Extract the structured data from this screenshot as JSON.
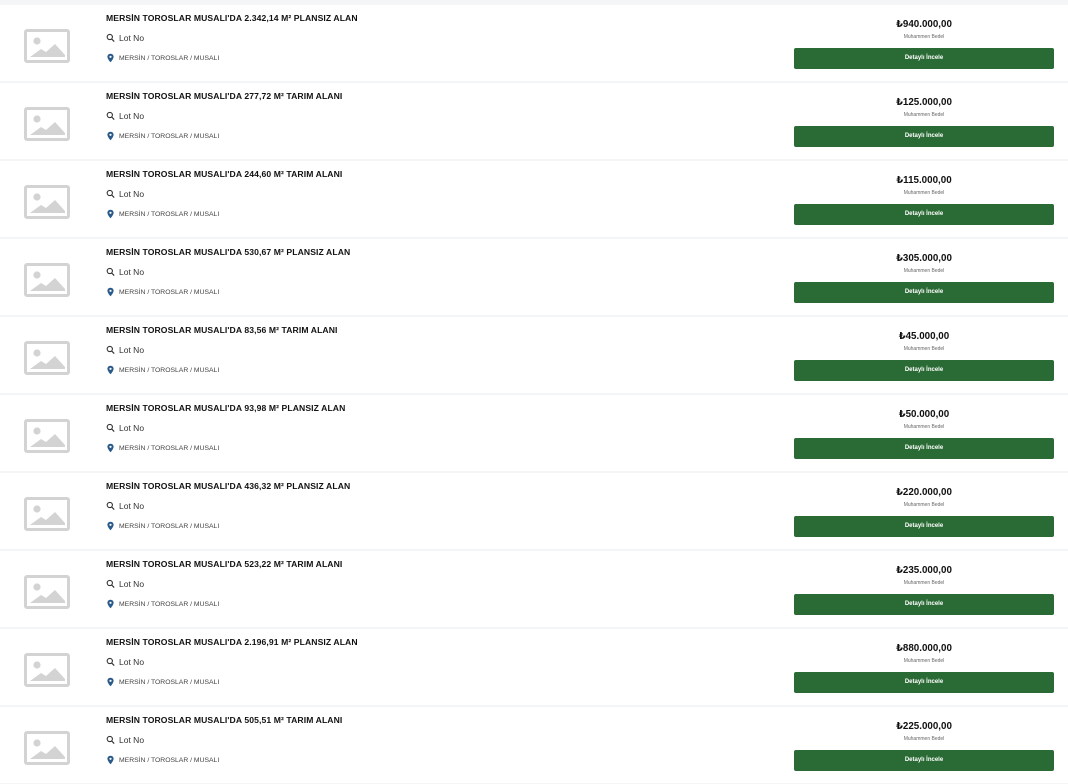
{
  "listings": [
    {
      "title": "MERSİN TOROSLAR MUSALI'DA 2.342,14 M² PLANSIZ ALAN",
      "lot_label": "Lot No",
      "location": "MERSİN / TOROSLAR / MUSALI",
      "price": "₺940.000,00",
      "price_label": "Muhammen Bedel",
      "button_label": "Detaylı İncele"
    },
    {
      "title": "MERSİN TOROSLAR MUSALI'DA 277,72 M² TARIM ALANI",
      "lot_label": "Lot No",
      "location": "MERSİN / TOROSLAR / MUSALI",
      "price": "₺125.000,00",
      "price_label": "Muhammen Bedel",
      "button_label": "Detaylı İncele"
    },
    {
      "title": "MERSİN TOROSLAR MUSALI'DA 244,60 M² TARIM ALANI",
      "lot_label": "Lot No",
      "location": "MERSİN / TOROSLAR / MUSALI",
      "price": "₺115.000,00",
      "price_label": "Muhammen Bedel",
      "button_label": "Detaylı İncele"
    },
    {
      "title": "MERSİN TOROSLAR MUSALI'DA 530,67 M² PLANSIZ ALAN",
      "lot_label": "Lot No",
      "location": "MERSİN / TOROSLAR / MUSALI",
      "price": "₺305.000,00",
      "price_label": "Muhammen Bedel",
      "button_label": "Detaylı İncele"
    },
    {
      "title": "MERSİN TOROSLAR MUSALI'DA 83,56 M² TARIM ALANI",
      "lot_label": "Lot No",
      "location": "MERSİN / TOROSLAR / MUSALI",
      "price": "₺45.000,00",
      "price_label": "Muhammen Bedel",
      "button_label": "Detaylı İncele"
    },
    {
      "title": "MERSİN TOROSLAR MUSALI'DA 93,98 M² PLANSIZ ALAN",
      "lot_label": "Lot No",
      "location": "MERSİN / TOROSLAR / MUSALI",
      "price": "₺50.000,00",
      "price_label": "Muhammen Bedel",
      "button_label": "Detaylı İncele"
    },
    {
      "title": "MERSİN TOROSLAR MUSALI'DA 436,32 M² PLANSIZ ALAN",
      "lot_label": "Lot No",
      "location": "MERSİN / TOROSLAR / MUSALI",
      "price": "₺220.000,00",
      "price_label": "Muhammen Bedel",
      "button_label": "Detaylı İncele"
    },
    {
      "title": "MERSİN TOROSLAR MUSALI'DA 523,22 M² TARIM ALANI",
      "lot_label": "Lot No",
      "location": "MERSİN / TOROSLAR / MUSALI",
      "price": "₺235.000,00",
      "price_label": "Muhammen Bedel",
      "button_label": "Detaylı İncele"
    },
    {
      "title": "MERSİN TOROSLAR MUSALI'DA 2.196,91 M² PLANSIZ ALAN",
      "lot_label": "Lot No",
      "location": "MERSİN / TOROSLAR / MUSALI",
      "price": "₺880.000,00",
      "price_label": "Muhammen Bedel",
      "button_label": "Detaylı İncele"
    },
    {
      "title": "MERSİN TOROSLAR MUSALI'DA 505,51 M² TARIM ALANI",
      "lot_label": "Lot No",
      "location": "MERSİN / TOROSLAR / MUSALI",
      "price": "₺225.000,00",
      "price_label": "Muhammen Bedel",
      "button_label": "Detaylı İncele"
    }
  ],
  "icons": {
    "thumbnail": "image-placeholder-icon",
    "lot": "search-icon",
    "location": "map-pin-icon"
  },
  "colors": {
    "button_bg": "#2a6a35",
    "button_text": "#ffffff",
    "row_bg": "#ffffff",
    "separator": "#f4f5f6",
    "placeholder": "#d3d3d3"
  }
}
